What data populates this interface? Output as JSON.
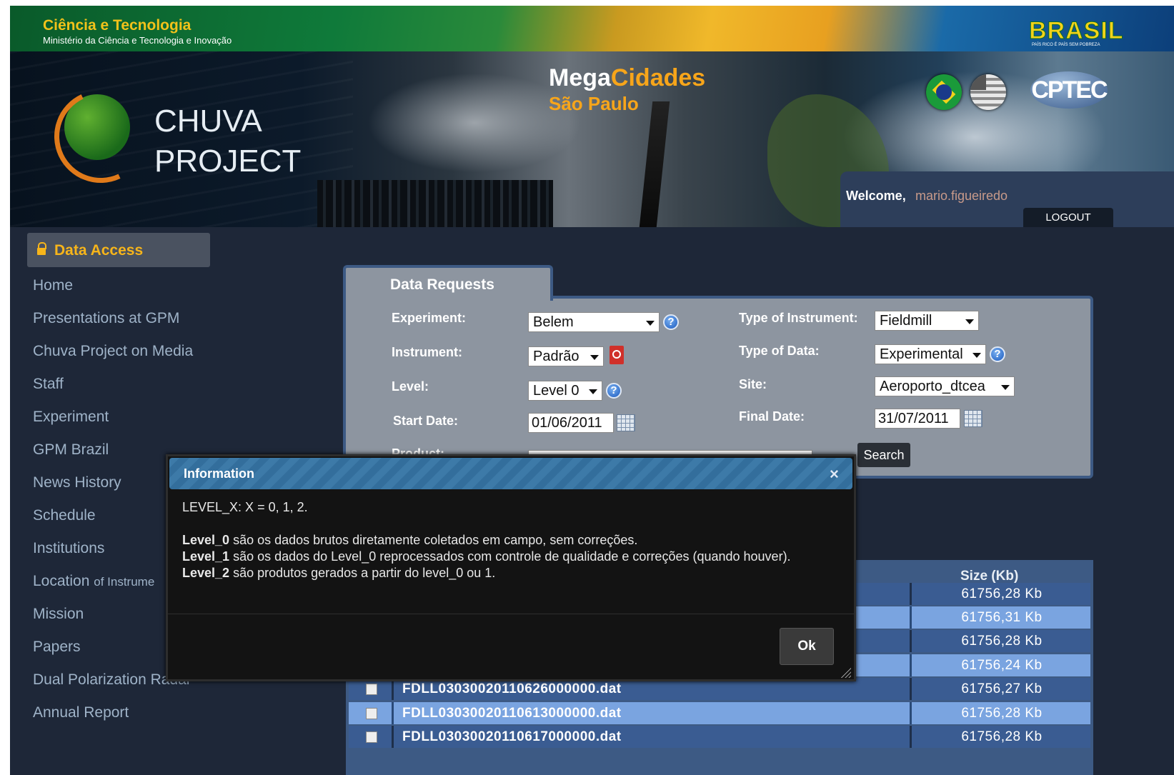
{
  "gov_bar": {
    "title": "Ciência e Tecnologia",
    "subtitle": "Ministério da Ciência e Tecnologia e Inovação",
    "brasil_logo": "BRASIL",
    "brasil_tagline": "PAÍS RICO É PAÍS SEM POBREZA"
  },
  "banner": {
    "logo_line1": "CHUVA",
    "logo_line2": "PROJECT",
    "mega_part1": "Mega",
    "mega_part2": "Cidades",
    "city": "São Paulo",
    "cptec_logo": "CPTEC"
  },
  "user_box": {
    "welcome_label": "Welcome,",
    "username": "mario.figueiredo",
    "logout_label": "LOGOUT"
  },
  "sidebar": {
    "title": "Data Access",
    "items": [
      {
        "label": "Home"
      },
      {
        "label": "Presentations at GPM"
      },
      {
        "label": "Chuva Project on Media"
      },
      {
        "label": "Staff"
      },
      {
        "label": "Experiment"
      },
      {
        "label": "GPM Brazil"
      },
      {
        "label": "News History"
      },
      {
        "label": "Schedule"
      },
      {
        "label": "Institutions"
      },
      {
        "label": "Location",
        "suffix": "of Instrume"
      },
      {
        "label": "Mission"
      },
      {
        "label": "Papers"
      },
      {
        "label": "Dual Polarization Radar"
      },
      {
        "label": "Annual Report"
      }
    ]
  },
  "form": {
    "tab_title": "Data Requests",
    "experiment_label": "Experiment:",
    "experiment_value": "Belem",
    "instrument_label": "Instrument:",
    "instrument_value": "Padrão",
    "level_label": "Level:",
    "level_value": "Level 0",
    "start_date_label": "Start Date:",
    "start_date_value": "01/06/2011",
    "product_label": "Product:",
    "instrument_type_label": "Type of Instrument:",
    "instrument_type_value": "Fieldmill",
    "data_type_label": "Type of Data:",
    "data_type_value": "Experimental",
    "site_label": "Site:",
    "site_value": "Aeroporto_dtcea",
    "final_date_label": "Final Date:",
    "final_date_value": "31/07/2011",
    "search_label": "Search",
    "help_glyph": "?"
  },
  "results": {
    "size_header": "Size (Kb)",
    "rows": [
      {
        "file": "",
        "size": "61756,28 Kb"
      },
      {
        "file": "",
        "size": "61756,31 Kb"
      },
      {
        "file": "",
        "size": "61756,28 Kb"
      },
      {
        "file": "",
        "size": "61756,24 Kb"
      },
      {
        "file": "FDLL03030020110626000000.dat",
        "size": "61756,27 Kb"
      },
      {
        "file": "FDLL03030020110613000000.dat",
        "size": "61756,28 Kb"
      },
      {
        "file": "FDLL03030020110617000000.dat",
        "size": "61756,28 Kb"
      }
    ]
  },
  "modal": {
    "title": "Information",
    "close_glyph": "×",
    "intro": "LEVEL_X: X = 0, 1, 2.",
    "l0_term": "Level_0",
    "l0_text": " são os dados brutos diretamente coletados em campo, sem correções.",
    "l1_term": "Level_1",
    "l1_text": " são os dados do Level_0 reprocessados com controle de qualidade e correções (quando houver).",
    "l2_term": "Level_2",
    "l2_text": " são produtos gerados a partir do level_0 ou 1.",
    "ok_label": "Ok"
  },
  "colors": {
    "accent_orange": "#f7a51a",
    "nav_text": "#9fb3c8",
    "panel_border": "#3d5a84",
    "row_dark": "#3a5c92",
    "row_light": "#7aa4e0"
  },
  "icons": {
    "lock": "lock-icon",
    "help": "help-icon",
    "pdf": "pdf-icon",
    "calendar": "calendar-icon",
    "close": "close-icon",
    "resize": "resize-grip-icon"
  }
}
